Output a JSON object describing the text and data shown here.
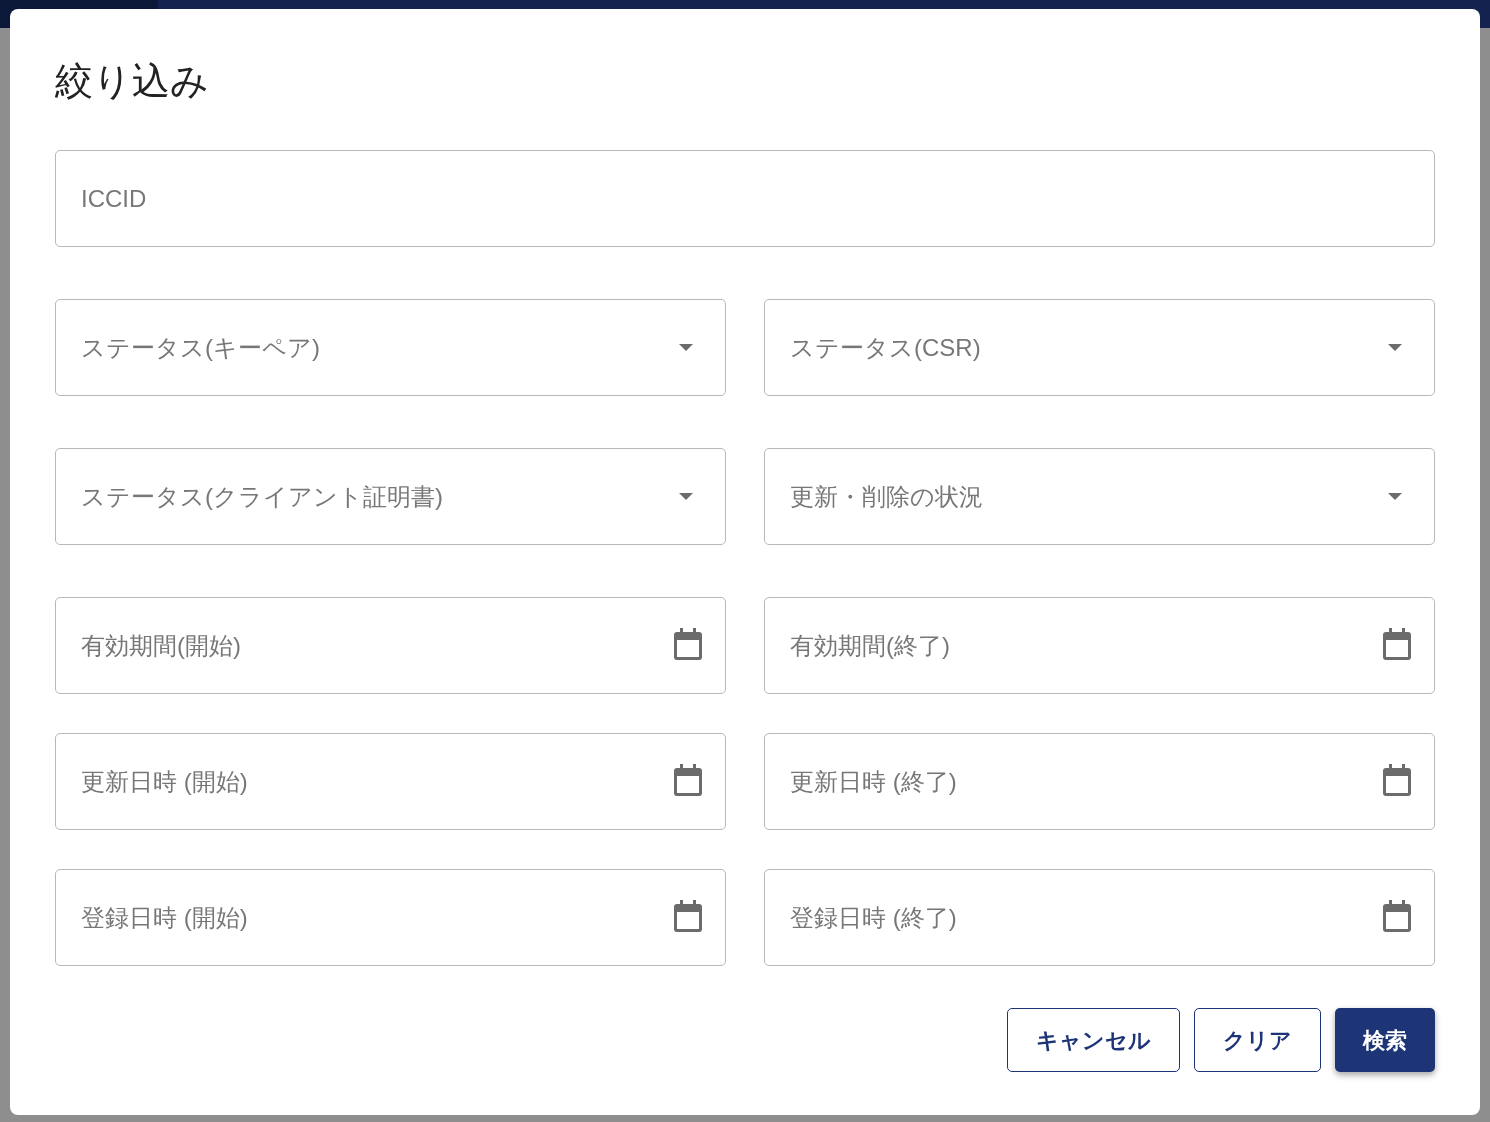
{
  "dialog": {
    "title": "絞り込み",
    "fields": [
      {
        "kind": "text",
        "placeholder": "ICCID"
      },
      {
        "kind": "select",
        "placeholder": "ステータス(キーペア)"
      },
      {
        "kind": "select",
        "placeholder": "ステータス(CSR)"
      },
      {
        "kind": "select",
        "placeholder": "ステータス(クライアント証明書)"
      },
      {
        "kind": "select",
        "placeholder": "更新・削除の状況"
      },
      {
        "kind": "date",
        "placeholder": "有効期間(開始)"
      },
      {
        "kind": "date",
        "placeholder": "有効期間(終了)"
      },
      {
        "kind": "date",
        "placeholder": "更新日時 (開始)"
      },
      {
        "kind": "date",
        "placeholder": "更新日時 (終了)"
      },
      {
        "kind": "date",
        "placeholder": "登録日時 (開始)"
      },
      {
        "kind": "date",
        "placeholder": "登録日時 (終了)"
      }
    ],
    "buttons": [
      {
        "kind": "outlined",
        "label": "キャンセル"
      },
      {
        "kind": "outlined",
        "label": "クリア"
      },
      {
        "kind": "primary",
        "label": "検索"
      }
    ]
  }
}
